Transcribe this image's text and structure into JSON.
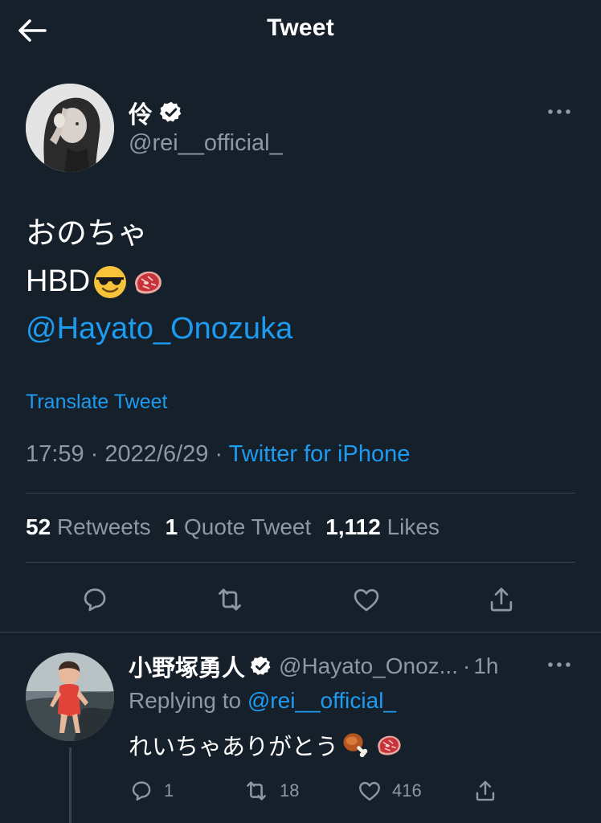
{
  "header": {
    "title": "Tweet"
  },
  "tweet": {
    "author_name": "伶",
    "author_handle": "@rei__official_",
    "lines": [
      "おのちゃ",
      "HBD"
    ],
    "mention": "@Hayato_Onozuka",
    "translate": "Translate Tweet",
    "time": "17:59",
    "separator": "·",
    "date": "2022/6/29",
    "source": "Twitter for iPhone",
    "stats": {
      "retweets_count": "52",
      "retweets_label": "Retweets",
      "quotes_count": "1",
      "quotes_label": "Quote Tweet",
      "likes_count": "1,112",
      "likes_label": "Likes"
    }
  },
  "reply": {
    "author_name": "小野塚勇人",
    "author_handle": "@Hayato_Onoz...",
    "separator": "·",
    "age": "1h",
    "replying_prefix": "Replying to",
    "replying_to": "@rei__official_",
    "text": "れいちゃありがとう",
    "reply_count": "1",
    "retweet_count": "18",
    "like_count": "416"
  },
  "icons": {
    "back": "arrow-left-icon",
    "verified": "verified-badge-icon",
    "more": "more-horizontal-icon",
    "reply": "speech-bubble-icon",
    "retweet": "retweet-icon",
    "like": "heart-icon",
    "share": "share-icon",
    "emoji_1": "sunglasses-emoji-icon",
    "emoji_2": "meat-emoji-icon",
    "emoji_3": "meat-on-bone-emoji-icon"
  },
  "colors": {
    "background": "#15202b",
    "text": "#ffffff",
    "secondary": "#8b98a5",
    "link": "#1d9bf0",
    "divider": "#38444d"
  }
}
